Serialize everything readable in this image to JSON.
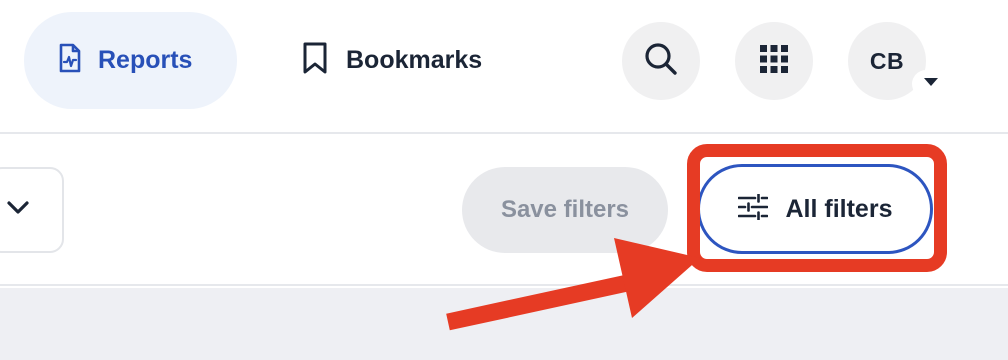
{
  "header": {
    "nav": {
      "reports_label": "Reports",
      "bookmarks_label": "Bookmarks"
    },
    "actions": {
      "search_icon": "search-icon",
      "apps_icon": "grid-icon",
      "avatar_initials": "CB",
      "avatar_menu_icon": "caret-down-icon"
    }
  },
  "toolbar": {
    "dropdown_icon": "chevron-down-icon",
    "save_filters_label": "Save filters",
    "all_filters_label": "All filters",
    "all_filters_icon": "sliders-icon"
  },
  "annotation": {
    "highlight_color": "#e63b24",
    "target": "all-filters-button"
  },
  "colors": {
    "accent_blue": "#2850b8",
    "active_nav_bg": "#eef3fb",
    "text_dark": "#1b2536",
    "disabled_text": "#8a919e",
    "content_bg": "#eeeff3"
  }
}
